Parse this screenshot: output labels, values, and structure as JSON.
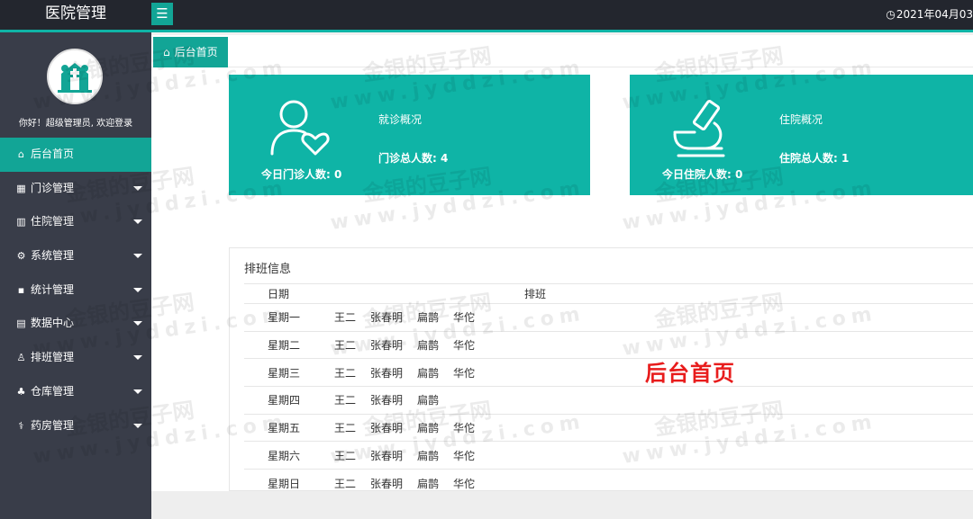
{
  "header": {
    "brand": "医院管理",
    "date_text": "2021年04月03",
    "menu_icon": "☰"
  },
  "sidebar": {
    "greeting": "你好！超级管理员, 欢迎登录",
    "items": [
      {
        "label": "后台首页",
        "icon": "home-icon",
        "glyph": "⌂",
        "active": true,
        "has_caret": false
      },
      {
        "label": "门诊管理",
        "icon": "grid-icon",
        "glyph": "▦",
        "has_caret": true
      },
      {
        "label": "住院管理",
        "icon": "book-icon",
        "glyph": "▥",
        "has_caret": true
      },
      {
        "label": "系统管理",
        "icon": "gear-icon",
        "glyph": "⚙",
        "has_caret": true
      },
      {
        "label": "统计管理",
        "icon": "monitor-icon",
        "glyph": "▪",
        "has_caret": true
      },
      {
        "label": "数据中心",
        "icon": "file-icon",
        "glyph": "▤",
        "has_caret": true
      },
      {
        "label": "排班管理",
        "icon": "user-icon",
        "glyph": "♙",
        "has_caret": true
      },
      {
        "label": "仓库管理",
        "icon": "warehouse-icon",
        "glyph": "♣",
        "has_caret": true
      },
      {
        "label": "药房管理",
        "icon": "pharmacy-icon",
        "glyph": "⚕",
        "has_caret": true
      }
    ]
  },
  "tabs": [
    {
      "label": "后台首页",
      "icon": "home-icon"
    }
  ],
  "cards": {
    "outpatient": {
      "title": "就诊概况",
      "total": "门诊总人数: 4",
      "today": "今日门诊人数: 0"
    },
    "inpatient": {
      "title": "住院概况",
      "total": "住院总人数: 1",
      "today": "今日住院人数: 0"
    }
  },
  "schedule": {
    "title": "排班信息",
    "headers": [
      "日期",
      "排班"
    ],
    "rows": [
      {
        "day": "星期一",
        "names": [
          "王二",
          "张春明",
          "扁鹊",
          "华佗"
        ]
      },
      {
        "day": "星期二",
        "names": [
          "王二",
          "张春明",
          "扁鹊",
          "华佗"
        ]
      },
      {
        "day": "星期三",
        "names": [
          "王二",
          "张春明",
          "扁鹊",
          "华佗"
        ]
      },
      {
        "day": "星期四",
        "names": [
          "王二",
          "张春明",
          "扁鹊"
        ]
      },
      {
        "day": "星期五",
        "names": [
          "王二",
          "张春明",
          "扁鹊",
          "华佗"
        ]
      },
      {
        "day": "星期六",
        "names": [
          "王二",
          "张春明",
          "扁鹊",
          "华佗"
        ]
      },
      {
        "day": "星期日",
        "names": [
          "王二",
          "张春明",
          "扁鹊",
          "华佗"
        ]
      }
    ]
  },
  "overlay_label": "后台首页",
  "watermark": {
    "cn": "金银的豆子网",
    "en": "www.jyddzi.com"
  },
  "colors": {
    "accent": "#0fb4a6",
    "sidebar": "#393d49",
    "topbar": "#23262e",
    "overlay_text": "#e81c1c"
  }
}
